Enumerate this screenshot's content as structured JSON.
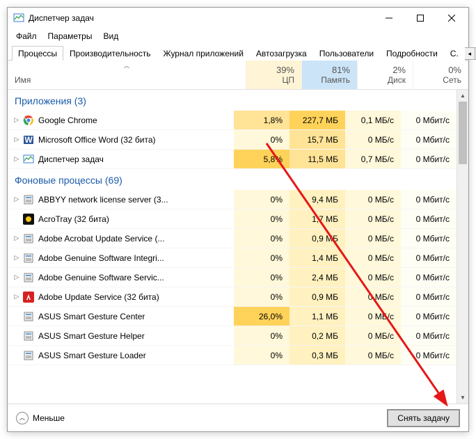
{
  "window": {
    "title": "Диспетчер задач"
  },
  "menu": [
    "Файл",
    "Параметры",
    "Вид"
  ],
  "tabs": [
    "Процессы",
    "Производительность",
    "Журнал приложений",
    "Автозагрузка",
    "Пользователи",
    "Подробности",
    "С."
  ],
  "active_tab": 0,
  "columns": {
    "name": "Имя",
    "metrics": [
      {
        "pct": "39%",
        "label": "ЦП",
        "tone": "hot"
      },
      {
        "pct": "81%",
        "label": "Память",
        "tone": "hotter hov"
      },
      {
        "pct": "2%",
        "label": "Диск",
        "tone": ""
      },
      {
        "pct": "0%",
        "label": "Сеть",
        "tone": ""
      }
    ]
  },
  "groups": [
    {
      "title": "Приложения (3)",
      "rows": [
        {
          "expand": true,
          "icon": "chrome",
          "name": "Google Chrome",
          "cells": [
            {
              "v": "1,8%",
              "bg": "bg-med"
            },
            {
              "v": "227,7 МБ",
              "bg": "bg-dark"
            },
            {
              "v": "0,1 МБ/с",
              "bg": "bg-vlight"
            },
            {
              "v": "0 Мбит/с",
              "bg": "bg-none"
            }
          ]
        },
        {
          "expand": true,
          "icon": "word",
          "name": "Microsoft Office Word (32 бита)",
          "cells": [
            {
              "v": "0%",
              "bg": "bg-vlight"
            },
            {
              "v": "15,7 МБ",
              "bg": "bg-med"
            },
            {
              "v": "0 МБ/с",
              "bg": "bg-vlight"
            },
            {
              "v": "0 Мбит/с",
              "bg": "bg-none"
            }
          ]
        },
        {
          "expand": true,
          "icon": "taskmgr",
          "name": "Диспетчер задач",
          "cells": [
            {
              "v": "5,8%",
              "bg": "bg-dark"
            },
            {
              "v": "11,5 МБ",
              "bg": "bg-med"
            },
            {
              "v": "0,7 МБ/с",
              "bg": "bg-vlight"
            },
            {
              "v": "0 Мбит/с",
              "bg": "bg-none"
            }
          ]
        }
      ]
    },
    {
      "title": "Фоновые процессы (69)",
      "rows": [
        {
          "expand": true,
          "icon": "abbyy",
          "name": "ABBYY network license server (3...",
          "cells": [
            {
              "v": "0%",
              "bg": "bg-vlight"
            },
            {
              "v": "9,4 МБ",
              "bg": "bg-light"
            },
            {
              "v": "0 МБ/с",
              "bg": "bg-vlight"
            },
            {
              "v": "0 Мбит/с",
              "bg": "bg-none"
            }
          ]
        },
        {
          "expand": false,
          "icon": "acro",
          "name": "AcroTray (32 бита)",
          "cells": [
            {
              "v": "0%",
              "bg": "bg-vlight"
            },
            {
              "v": "1,7 МБ",
              "bg": "bg-light"
            },
            {
              "v": "0 МБ/с",
              "bg": "bg-vlight"
            },
            {
              "v": "0 Мбит/с",
              "bg": "bg-none"
            }
          ]
        },
        {
          "expand": true,
          "icon": "generic",
          "name": "Adobe Acrobat Update Service (...",
          "cells": [
            {
              "v": "0%",
              "bg": "bg-vlight"
            },
            {
              "v": "0,9 МБ",
              "bg": "bg-light"
            },
            {
              "v": "0 МБ/с",
              "bg": "bg-vlight"
            },
            {
              "v": "0 Мбит/с",
              "bg": "bg-none"
            }
          ]
        },
        {
          "expand": true,
          "icon": "adobe-g",
          "name": "Adobe Genuine Software Integri...",
          "cells": [
            {
              "v": "0%",
              "bg": "bg-vlight"
            },
            {
              "v": "1,4 МБ",
              "bg": "bg-light"
            },
            {
              "v": "0 МБ/с",
              "bg": "bg-vlight"
            },
            {
              "v": "0 Мбит/с",
              "bg": "bg-none"
            }
          ]
        },
        {
          "expand": true,
          "icon": "adobe-g",
          "name": "Adobe Genuine Software Servic...",
          "cells": [
            {
              "v": "0%",
              "bg": "bg-vlight"
            },
            {
              "v": "2,4 МБ",
              "bg": "bg-light"
            },
            {
              "v": "0 МБ/с",
              "bg": "bg-vlight"
            },
            {
              "v": "0 Мбит/с",
              "bg": "bg-none"
            }
          ]
        },
        {
          "expand": true,
          "icon": "adobe-u",
          "name": "Adobe Update Service (32 бита)",
          "cells": [
            {
              "v": "0%",
              "bg": "bg-vlight"
            },
            {
              "v": "0,9 МБ",
              "bg": "bg-light"
            },
            {
              "v": "0 МБ/с",
              "bg": "bg-vlight"
            },
            {
              "v": "0 Мбит/с",
              "bg": "bg-none"
            }
          ]
        },
        {
          "expand": false,
          "icon": "asus",
          "name": "ASUS Smart Gesture Center",
          "cells": [
            {
              "v": "26,0%",
              "bg": "bg-dark"
            },
            {
              "v": "1,1 МБ",
              "bg": "bg-light"
            },
            {
              "v": "0 МБ/с",
              "bg": "bg-vlight"
            },
            {
              "v": "0 Мбит/с",
              "bg": "bg-none"
            }
          ]
        },
        {
          "expand": false,
          "icon": "asus",
          "name": "ASUS Smart Gesture Helper",
          "cells": [
            {
              "v": "0%",
              "bg": "bg-vlight"
            },
            {
              "v": "0,2 МБ",
              "bg": "bg-light"
            },
            {
              "v": "0 МБ/с",
              "bg": "bg-vlight"
            },
            {
              "v": "0 Мбит/с",
              "bg": "bg-none"
            }
          ]
        },
        {
          "expand": false,
          "icon": "asus",
          "name": "ASUS Smart Gesture Loader",
          "cells": [
            {
              "v": "0%",
              "bg": "bg-vlight"
            },
            {
              "v": "0,3 МБ",
              "bg": "bg-light"
            },
            {
              "v": "0 МБ/с",
              "bg": "bg-vlight"
            },
            {
              "v": "0 Мбит/с",
              "bg": "bg-none"
            }
          ]
        }
      ]
    }
  ],
  "footer": {
    "less": "Меньше",
    "end_task": "Снять задачу"
  }
}
